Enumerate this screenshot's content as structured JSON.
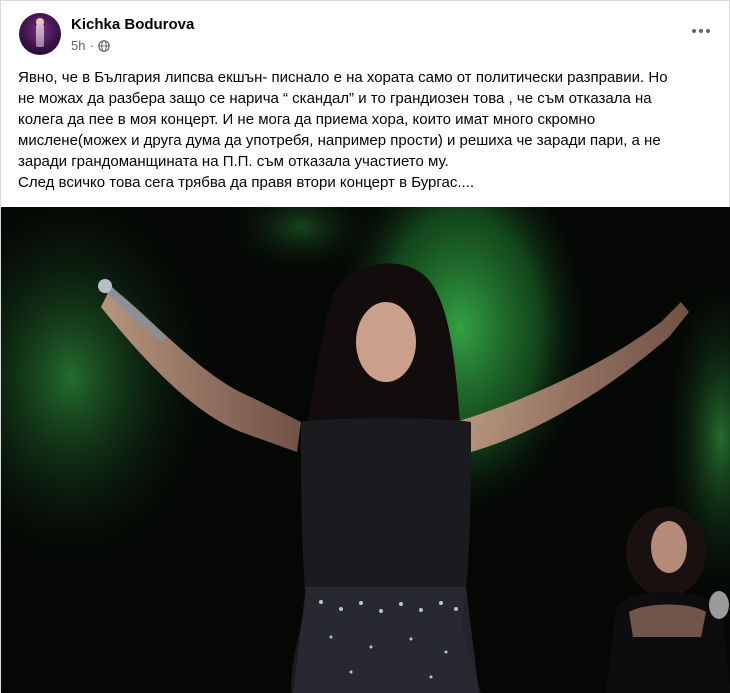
{
  "post": {
    "author": "Kichka Bodurova",
    "time": "5h",
    "privacy_icon": "globe-icon",
    "more_icon": "more-options-icon",
    "text_lines": [
      "Явно, че в България липсва екшън- писнало е на хората само от политически  разправии. Но",
      "не можах да разбера защо се нарича “ скандал” и то грандиозен това , че съм отказала на",
      "колега да пее в моя концерт. И не мога да приема хора, които имат много скромно",
      "мислене(можех и друга дума да употребя, например прости) и решиха че заради пари, а не",
      "заради грандоманщината на П.П. съм отказала участието му.",
      "След всичко това сега трябва  да правя втори концерт в Бургас...."
    ]
  },
  "colors": {
    "name": "#050505",
    "meta": "#65676b",
    "stage_green": "#1f8a3a",
    "background": "#ffffff"
  }
}
